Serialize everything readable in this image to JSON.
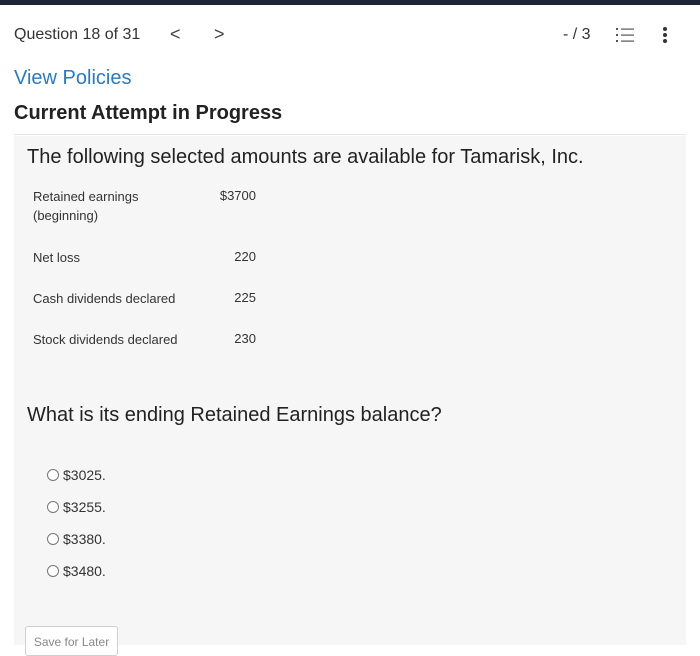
{
  "header": {
    "question_counter": "Question 18 of 31",
    "prev_glyph": "<",
    "next_glyph": ">",
    "score": "- / 3"
  },
  "links": {
    "view_policies": "View Policies"
  },
  "section_title": "Current Attempt in Progress",
  "problem": {
    "intro": "The following selected amounts are available for Tamarisk, Inc.",
    "rows": [
      {
        "label": "Retained earnings (beginning)",
        "value": "$3700"
      },
      {
        "label": "Net loss",
        "value": "220"
      },
      {
        "label": "Cash dividends declared",
        "value": "225"
      },
      {
        "label": "Stock dividends declared",
        "value": "230"
      }
    ],
    "question": "What is its ending Retained Earnings balance?",
    "options": [
      "$3025.",
      "$3255.",
      "$3380.",
      "$3480."
    ]
  },
  "buttons": {
    "save_for_later": "Save for Later"
  },
  "colors": {
    "top_bar": "#1e2438",
    "link": "#2b7bb9",
    "panel_bg": "#f6f6f6"
  },
  "icons": {
    "list": "list-icon",
    "more": "more-vertical-icon"
  }
}
